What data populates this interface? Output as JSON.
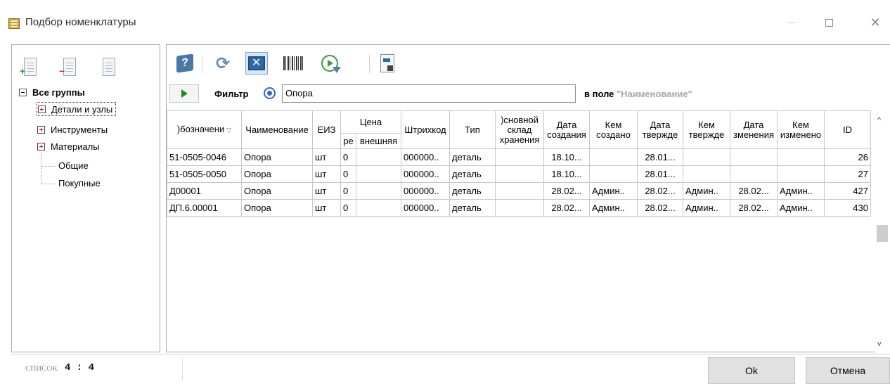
{
  "window": {
    "title": "Подбор номенклатуры",
    "minimize_icon": "minimize-icon",
    "maximize_icon": "maximize-icon",
    "close_glyph": "✕"
  },
  "tree": {
    "root_label": "Все группы",
    "groups": [
      {
        "label": "Детали и узлы",
        "selected": true
      },
      {
        "label": "Инструменты",
        "selected": false
      },
      {
        "label": "Материалы",
        "selected": false
      }
    ],
    "leaves": [
      "Общие",
      "Покупные"
    ]
  },
  "filter": {
    "label": "Фильтр",
    "value": "Опора",
    "field_prefix": "в поле",
    "field_name": "\"Наименование\""
  },
  "grid": {
    "headers": {
      "designation": ")бозначени",
      "name": "Чаименование",
      "unit": "ЕИЗ",
      "price": "Цена",
      "price_sub1": "ре",
      "price_sub2": "внешняя",
      "barcode": "Штрихкод",
      "type": "Тип",
      "main_warehouse": ")сновной склад хранения",
      "created_date": "Дата создания",
      "created_by": "Кем создано",
      "approved_date": "Дата твержде",
      "approved_by": "Кем твержде",
      "modified_date": "Дата зменения",
      "modified_by": "Кем изменено",
      "id": "ID"
    },
    "rows": [
      {
        "designation": "51-0505-0046",
        "name": "Опора",
        "unit": "шт",
        "price_int": "0",
        "price_ext": "",
        "barcode": "000000..",
        "type": "деталь",
        "warehouse": "",
        "created_date": "18.10...",
        "created_by": "",
        "approved_date": "28.01...",
        "approved_by": "",
        "modified_date": "",
        "modified_by": "",
        "id": "26"
      },
      {
        "designation": "51-0505-0050",
        "name": "Опора",
        "unit": "шт",
        "price_int": "0",
        "price_ext": "",
        "barcode": "000000..",
        "type": "деталь",
        "warehouse": "",
        "created_date": "18.10...",
        "created_by": "",
        "approved_date": "28.01...",
        "approved_by": "",
        "modified_date": "",
        "modified_by": "",
        "id": "27"
      },
      {
        "designation": "Д00001",
        "name": "Опора",
        "unit": "шт",
        "price_int": "0",
        "price_ext": "",
        "barcode": "000000..",
        "type": "деталь",
        "warehouse": "",
        "created_date": "28.02...",
        "created_by": "Админ..",
        "approved_date": "28.02...",
        "approved_by": "Админ..",
        "modified_date": "28.02...",
        "modified_by": "Админ..",
        "id": "427"
      },
      {
        "designation": "ДП.6.00001",
        "name": "Опора",
        "unit": "шт",
        "price_int": "0",
        "price_ext": "",
        "barcode": "000000..",
        "type": "деталь",
        "warehouse": "",
        "created_date": "28.02...",
        "created_by": "Админ..",
        "approved_date": "28.02...",
        "approved_by": "Админ..",
        "modified_date": "28.02...",
        "modified_by": "Админ..",
        "id": "430"
      }
    ]
  },
  "status": {
    "caption": "СПИСОК",
    "count": "4 : 4"
  },
  "buttons": {
    "ok": "Ok",
    "cancel": "Отмена"
  }
}
